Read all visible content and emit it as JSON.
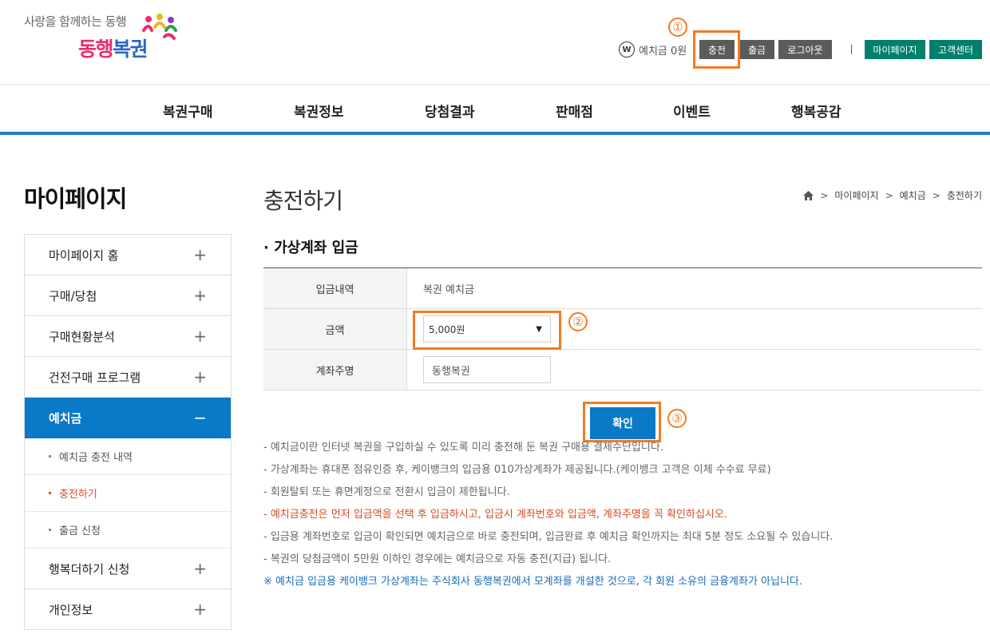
{
  "header": {
    "slogan": "사랑을 함께하는 동행",
    "logo": {
      "part1": "동행",
      "part2": "복권"
    },
    "won_icon_text": "W",
    "deposit_label": "예치금",
    "deposit_amount": "0원",
    "buttons": {
      "charge": "충전",
      "withdraw": "출금",
      "logout": "로그아웃",
      "mypage": "마이페이지",
      "customer_center": "고객센터"
    }
  },
  "gnb": [
    "복권구매",
    "복권정보",
    "당첨결과",
    "판매점",
    "이벤트",
    "행복공감"
  ],
  "sidebar": {
    "title": "마이페이지",
    "items": [
      {
        "label": "마이페이지 홈",
        "toggle": "+"
      },
      {
        "label": "구매/당첨",
        "toggle": "+"
      },
      {
        "label": "구매현황분석",
        "toggle": "+"
      },
      {
        "label": "건전구매 프로그램",
        "toggle": "+"
      },
      {
        "label": "예치금",
        "toggle": "−"
      },
      {
        "label": "행복더하기 신청",
        "toggle": "+"
      },
      {
        "label": "개인정보",
        "toggle": "+"
      }
    ],
    "sub_items": [
      "예치금 충전 내역",
      "충전하기",
      "출금 신청"
    ]
  },
  "content": {
    "page_title": "충전하기",
    "breadcrumb": [
      "마이페이지",
      "예치금",
      "충전하기"
    ],
    "section_title": "· 가상계좌 입금",
    "form": {
      "deposit_type_label": "입금내역",
      "deposit_type_value": "복권 예치금",
      "amount_label": "금액",
      "amount_value": "5,000원",
      "account_name_label": "계좌주명",
      "account_name_value": "동행복권"
    },
    "confirm_label": "확인",
    "notes": [
      "-  예치금이란 인터넷 복권을 구입하실 수 있도록 미리 충전해 둔 복권 구매용 결제수단입니다.",
      "-  가상계좌는 휴대폰 점유인증 후, 케이뱅크의 입금용 010가상계좌가 제공됩니다.(케이뱅크 고객은 이체 수수료 무료)",
      "-  회원탈퇴 또는 휴면계정으로 전환시 입금이 제한됩니다.",
      "-  예치금충전은 먼저 입금액을 선택 후 입금하시고, 입금시 계좌번호와 입금액, 계좌주명을 꼭 확인하십시오.",
      "-  입금용 계좌번호로 입금이 확인되면 예치금으로 바로 충전되며, 입금완료 후 예치금 확인까지는 최대 5분 정도 소요될 수 있습니다.",
      "-  복권의 당첨금액이 5만원 이하인 경우에는 예치금으로 자동 충전(지급) 됩니다.",
      "※ 예치금 입금용 케이뱅크 가상계좌는 주식회사 동행복권에서 모계좌를 개설한 것으로, 각 회원 소유의 금융계좌가 아닙니다."
    ]
  },
  "annotations": {
    "step1": "①",
    "step2": "②",
    "step3": "③"
  },
  "colors": {
    "accent_blue": "#0a79c6",
    "highlight_orange": "#f47a20",
    "green_button": "#00806a",
    "warning_red": "#d84a24"
  }
}
